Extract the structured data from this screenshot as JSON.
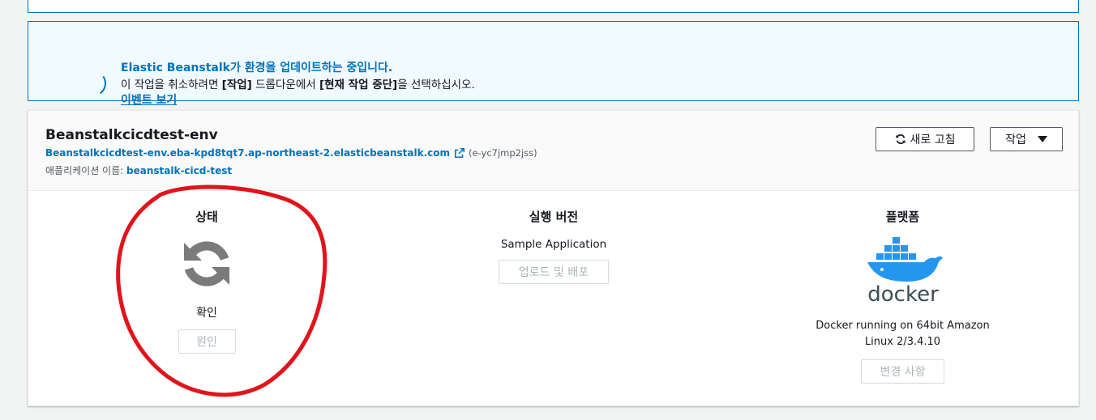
{
  "flash": {
    "title": "Elastic Beanstalk가 환경을 업데이트하는 중입니다.",
    "text_pre": "이 작업을 취소하려면 ",
    "text_bold1": "[작업]",
    "text_mid": " 드롭다운에서 ",
    "text_bold2": "[현재 작업 중단]",
    "text_post": "을 선택하십시오.",
    "link": "이벤트 보기"
  },
  "environment": {
    "name": "Beanstalkcicdtest-env",
    "url": "Beanstalkcicdtest-env.eba-kpd8tqt7.ap-northeast-2.elasticbeanstalk.com",
    "id": "(e-yc7jmp2jss)",
    "app_label": "애플리케이션 이름: ",
    "app_name": "beanstalk-cicd-test"
  },
  "header_buttons": {
    "refresh": "새로 고침",
    "actions": "작업"
  },
  "status": {
    "title": "상태",
    "value": "확인",
    "button": "원인"
  },
  "version": {
    "title": "실행 버전",
    "value": "Sample Application",
    "button": "업로드 및 배포"
  },
  "platform": {
    "title": "플랫폼",
    "logo_text": "docker",
    "value": "Docker running on 64bit Amazon Linux 2/3.4.10",
    "button": "변경 사항"
  },
  "colors": {
    "link": "#0073bb",
    "annotation": "#e0141b",
    "docker_blue": "#2496ed"
  }
}
